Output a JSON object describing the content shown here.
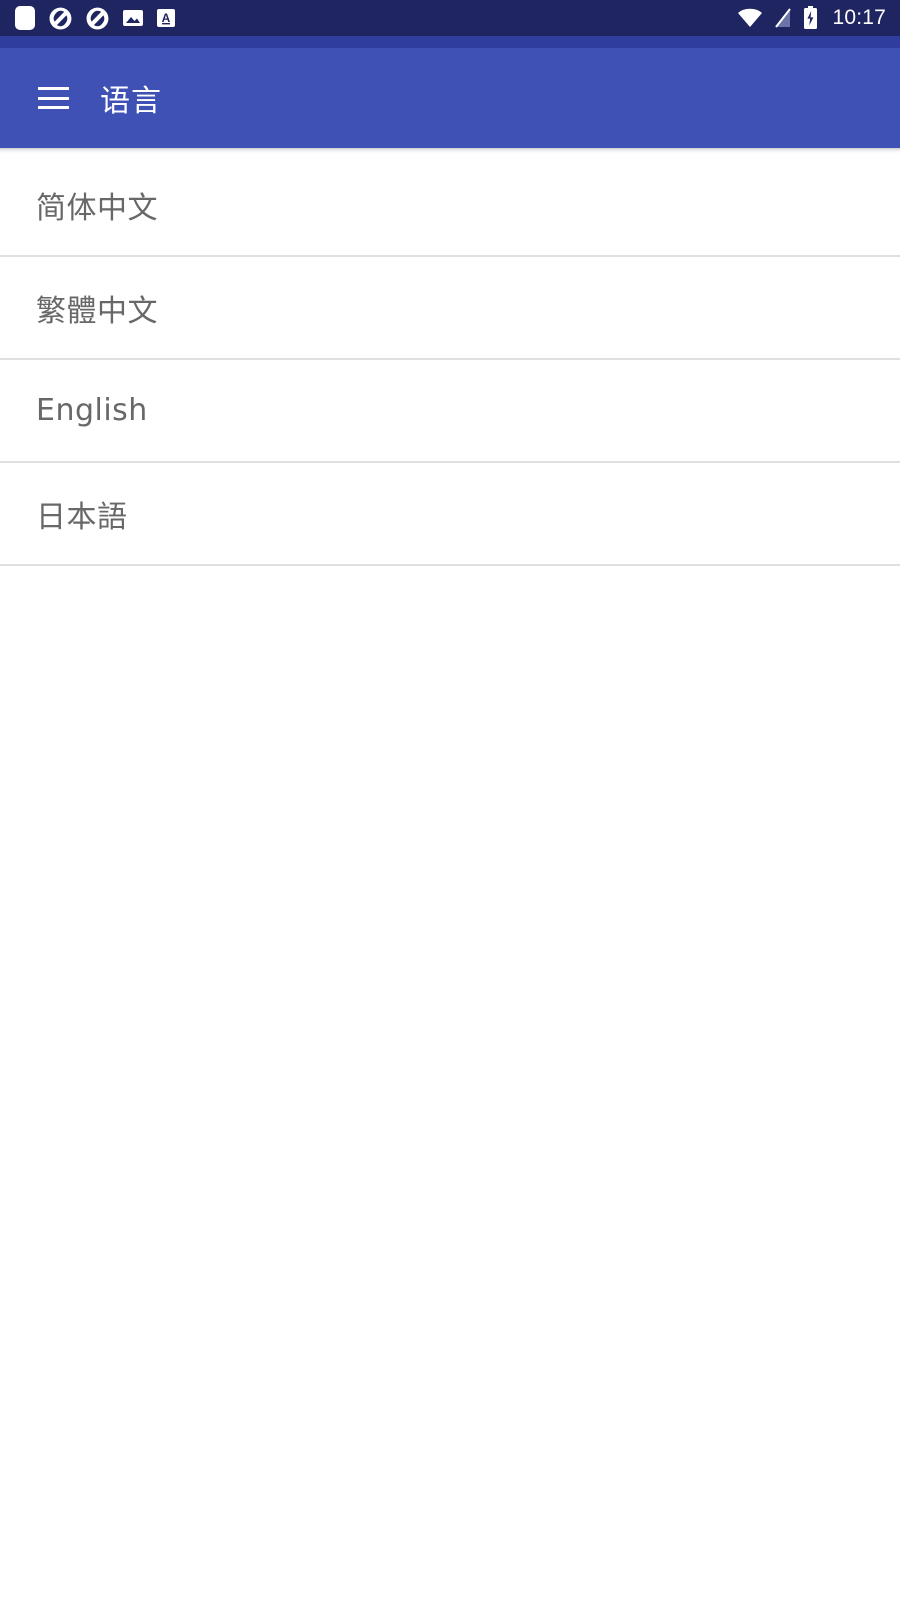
{
  "status_bar": {
    "background_color": "#1f2560",
    "time": "10:17",
    "left_icons": [
      {
        "name": "rounded-square-app-icon",
        "glyph": "rounded-square"
      },
      {
        "name": "swirl-app-icon-1",
        "glyph": "swirl"
      },
      {
        "name": "swirl-app-icon-2",
        "glyph": "swirl"
      },
      {
        "name": "image-notification-icon",
        "glyph": "image"
      },
      {
        "name": "text-font-notification-icon",
        "glyph": "letter-a"
      }
    ],
    "right_icons": [
      {
        "name": "wifi-icon",
        "glyph": "wifi"
      },
      {
        "name": "signal-off-icon",
        "glyph": "signal-slashed"
      },
      {
        "name": "battery-charging-icon",
        "glyph": "battery-bolt"
      }
    ]
  },
  "band": {
    "background_color": "#2f3d9e"
  },
  "app_bar": {
    "background_color": "#3f51b5",
    "title": "语言",
    "menu_icon": "hamburger-menu-icon"
  },
  "language_list": {
    "items": [
      {
        "label": "简体中文"
      },
      {
        "label": "繁體中文"
      },
      {
        "label": "English"
      },
      {
        "label": "日本語"
      }
    ],
    "divider_color": "#e0e0e0",
    "text_color": "#686868",
    "background_color": "#ffffff"
  }
}
